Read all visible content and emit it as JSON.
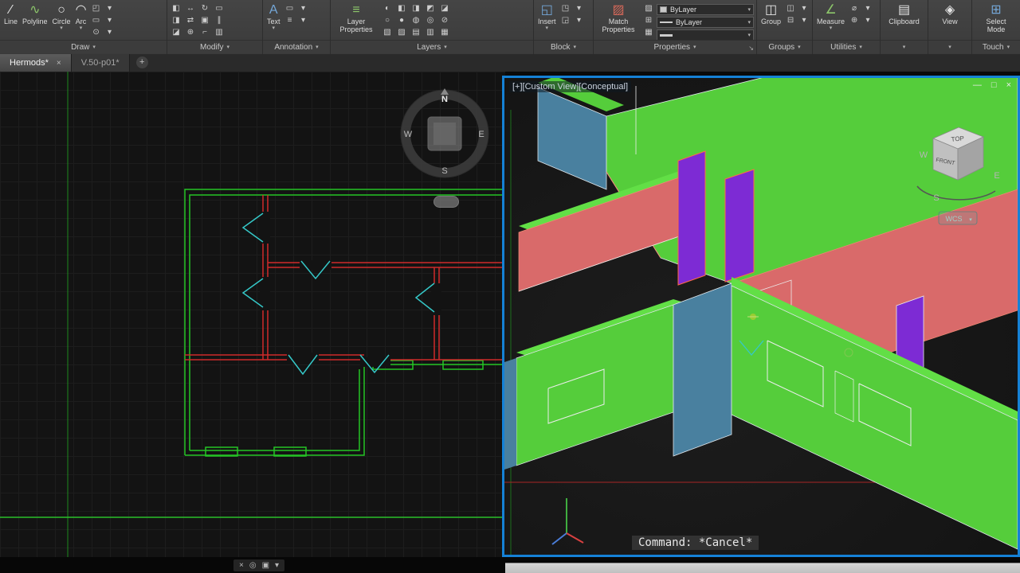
{
  "ribbon": {
    "buttons": {
      "line": "Line",
      "polyline": "Polyline",
      "circle": "Circle",
      "arc": "Arc",
      "text": "Text",
      "layer_properties": "Layer Properties",
      "insert": "Insert",
      "match_properties": "Match Properties",
      "group": "Group",
      "measure": "Measure",
      "clipboard": "Clipboard",
      "view": "View",
      "select_mode": "Select Mode"
    },
    "panels": {
      "draw": "Draw",
      "modify": "Modify",
      "annotation": "Annotation",
      "layers": "Layers",
      "block": "Block",
      "properties": "Properties",
      "groups": "Groups",
      "utilities": "Utilities",
      "touch": "Touch"
    },
    "properties_panel": {
      "color_value": "ByLayer",
      "linetype_value": "ByLayer"
    },
    "icons": {
      "line": "∕",
      "polyline": "∿",
      "circle": "○",
      "arc": "◠",
      "text": "A",
      "layer_properties": "≡",
      "insert": "◱",
      "match_properties": "▨",
      "group": "◫",
      "measure": "∠",
      "clipboard": "▤",
      "view": "◈",
      "select_mode": "⊞",
      "caret": "▾",
      "expander": "↘"
    },
    "small_icons": {
      "draw": [
        "◰",
        "▾",
        "▭",
        "▾",
        "⊙",
        "▾"
      ],
      "modify": [
        "◧",
        "↔",
        "↻",
        "▭",
        "◨",
        "⇄",
        "▣",
        "∥",
        "◪",
        "⊕",
        "⌐",
        "▥"
      ],
      "annotation": [
        "▭",
        "▾",
        "≡",
        "▾"
      ],
      "layers": [
        "◐",
        "◧",
        "◨",
        "◩",
        "◪",
        "○",
        "●",
        "◍",
        "◎",
        "⊘",
        "▧",
        "▨",
        "▤",
        "▥",
        "▦"
      ],
      "block": [
        "◳",
        "▾",
        "◲",
        "▾"
      ],
      "properties": [
        "▨",
        "⊞",
        "▦"
      ],
      "groups": [
        "◫",
        "▾",
        "⊟",
        "▾"
      ],
      "utilities": [
        "⌀",
        "▾",
        "⊕",
        "▾"
      ]
    }
  },
  "tabs": {
    "tab1": "Hermods*",
    "tab2": "V.50-p01*",
    "close": "×",
    "new": "+"
  },
  "viewport2d": {
    "compass": {
      "n": "N",
      "s": "S",
      "e": "E",
      "w": "W"
    }
  },
  "viewport3d": {
    "title": "[+][Custom View][Conceptual]",
    "controls": {
      "minimize": "—",
      "restore": "□",
      "close": "×"
    },
    "viewcube": {
      "top": "TOP",
      "front": "FRONT",
      "w": "W",
      "e": "E",
      "s": "S"
    },
    "wcs_label": "WCS",
    "command_text": "Command: *Cancel*"
  },
  "status_bar": {
    "icons": [
      "×",
      "◎",
      "▣",
      "▾"
    ]
  }
}
